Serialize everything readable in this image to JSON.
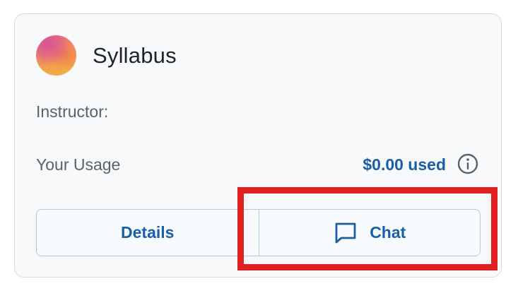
{
  "card": {
    "title": "Syllabus",
    "instructor_label": "Instructor:",
    "usage_label": "Your Usage",
    "usage_value": "$0.00 used"
  },
  "icons": {
    "avatar": "gradient-avatar",
    "info": "info-circle-icon",
    "chat": "chat-bubble-icon"
  },
  "buttons": {
    "details_label": "Details",
    "chat_label": "Chat"
  },
  "colors": {
    "accent": "#1a5ea4",
    "highlight": "#e02020",
    "border": "#a9c9e6"
  }
}
